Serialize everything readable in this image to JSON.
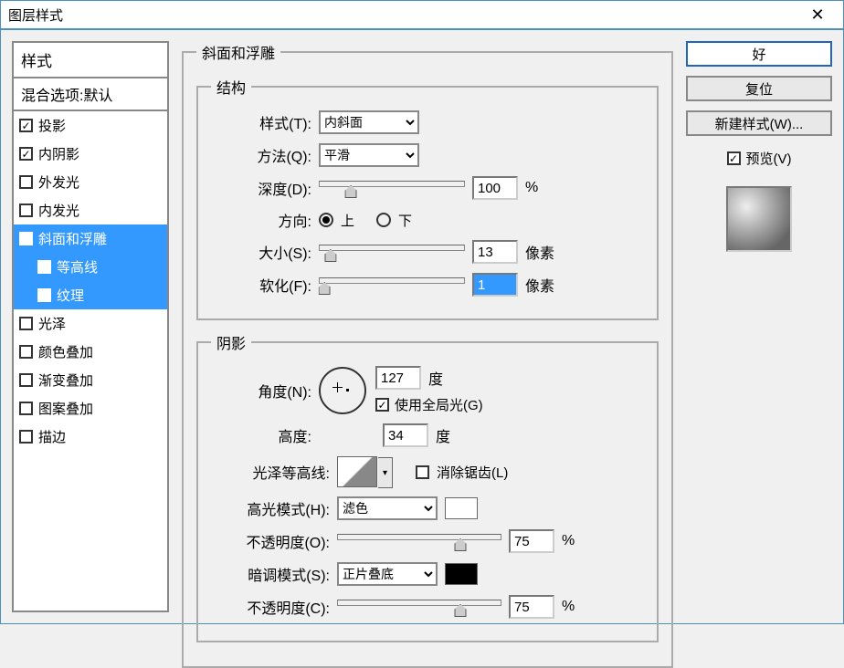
{
  "window": {
    "title": "图层样式"
  },
  "styles_panel": {
    "header": "样式",
    "blend_header": "混合选项:默认",
    "items": [
      {
        "label": "投影",
        "checked": true,
        "selected": false
      },
      {
        "label": "内阴影",
        "checked": true,
        "selected": false
      },
      {
        "label": "外发光",
        "checked": false,
        "selected": false
      },
      {
        "label": "内发光",
        "checked": false,
        "selected": false
      },
      {
        "label": "斜面和浮雕",
        "checked": true,
        "selected": true
      },
      {
        "label": "等高线",
        "checked": false,
        "selected": true,
        "sub": true
      },
      {
        "label": "纹理",
        "checked": false,
        "selected": true,
        "sub": true
      },
      {
        "label": "光泽",
        "checked": false,
        "selected": false
      },
      {
        "label": "颜色叠加",
        "checked": false,
        "selected": false
      },
      {
        "label": "渐变叠加",
        "checked": false,
        "selected": false
      },
      {
        "label": "图案叠加",
        "checked": false,
        "selected": false
      },
      {
        "label": "描边",
        "checked": false,
        "selected": false
      }
    ]
  },
  "bevel": {
    "title": "斜面和浮雕",
    "struct_title": "结构",
    "style_label": "样式(T):",
    "style_value": "内斜面",
    "technique_label": "方法(Q):",
    "technique_value": "平滑",
    "depth_label": "深度(D):",
    "depth_value": "100",
    "depth_unit": "%",
    "direction_label": "方向:",
    "up": "上",
    "down": "下",
    "dir": "up",
    "size_label": "大小(S):",
    "size_value": "13",
    "size_unit": "像素",
    "soften_label": "软化(F):",
    "soften_value": "1",
    "soften_unit": "像素"
  },
  "shading": {
    "title": "阴影",
    "angle_label": "角度(N):",
    "angle_value": "127",
    "angle_unit": "度",
    "global_label": "使用全局光(G)",
    "global_on": true,
    "altitude_label": "高度:",
    "altitude_value": "34",
    "altitude_unit": "度",
    "gloss_label": "光泽等高线:",
    "antialias_label": "消除锯齿(L)",
    "antialias_on": false,
    "highlight_mode_label": "高光模式(H):",
    "highlight_mode_value": "滤色",
    "highlight_op_label": "不透明度(O):",
    "highlight_op_value": "75",
    "op_unit": "%",
    "shadow_mode_label": "暗调模式(S):",
    "shadow_mode_value": "正片叠底",
    "shadow_op_label": "不透明度(C):",
    "shadow_op_value": "75"
  },
  "buttons": {
    "ok": "好",
    "cancel": "复位",
    "new_style": "新建样式(W)...",
    "preview": "预览(V)"
  }
}
